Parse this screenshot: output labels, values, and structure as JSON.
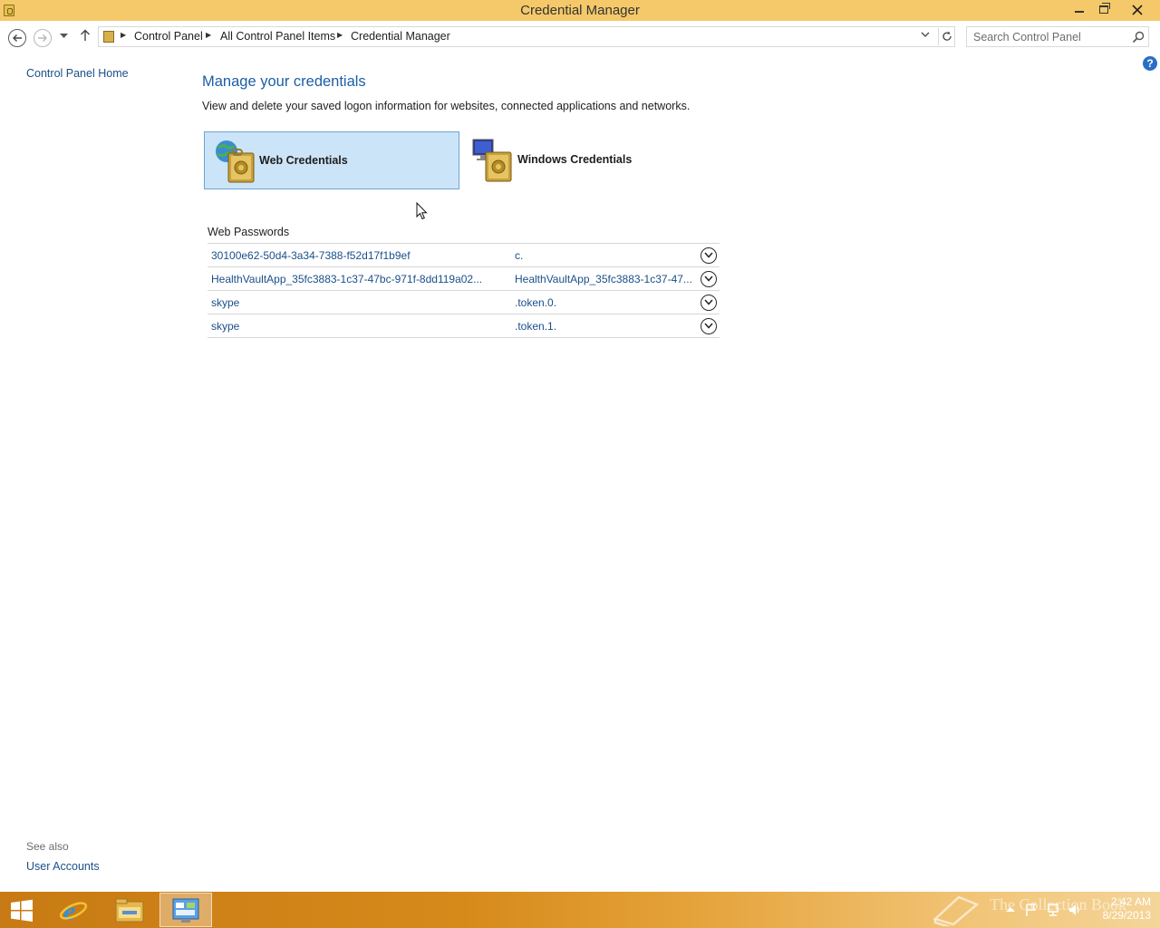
{
  "window": {
    "title": "Credential Manager",
    "accent_color": "#f5c96a"
  },
  "nav": {
    "breadcrumbs": [
      "Control Panel",
      "All Control Panel Items",
      "Credential Manager"
    ],
    "search_placeholder": "Search Control Panel"
  },
  "leftnav": {
    "home_label": "Control Panel Home",
    "see_also_label": "See also",
    "user_accounts_label": "User Accounts"
  },
  "main": {
    "heading": "Manage your credentials",
    "description": "View and delete your saved logon information for websites, connected applications and networks.",
    "tiles": [
      {
        "label": "Web Credentials",
        "selected": true
      },
      {
        "label": "Windows Credentials",
        "selected": false
      }
    ],
    "section_title": "Web Passwords",
    "credentials": [
      {
        "name": "30100e62-50d4-3a34-7388-f52d17f1b9ef",
        "user": "c."
      },
      {
        "name": "HealthVaultApp_35fc3883-1c37-47bc-971f-8dd119a02...",
        "user": "HealthVaultApp_35fc3883-1c37-47..."
      },
      {
        "name": "skype",
        "user": ".token.0."
      },
      {
        "name": "skype",
        "user": ".token.1."
      }
    ]
  },
  "taskbar": {
    "apps": [
      "start-icon",
      "internet-explorer-icon",
      "file-explorer-icon",
      "control-panel-icon"
    ],
    "clock_time": "2:42 AM",
    "clock_date": "8/29/2013",
    "watermark": "The Collection Book"
  }
}
